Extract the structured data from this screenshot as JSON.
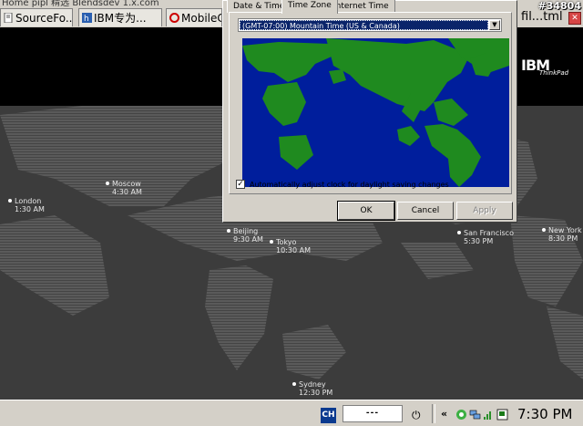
{
  "browser": {
    "top_strip_text": "Home   pipl 精选   Blendsdev 1.x.com",
    "tabs": [
      {
        "label": "SourceFo...",
        "icon": "page-icon"
      },
      {
        "label": "IBM专为...",
        "icon": "hyperlink-icon"
      },
      {
        "label": "MobileC",
        "icon": "opera-icon"
      }
    ],
    "right_title": "fil...tml",
    "stamp": "#34804"
  },
  "dialog": {
    "tabs": [
      "Date & Time",
      "Time Zone",
      "Internet Time"
    ],
    "active_tab": "Time Zone",
    "timezone_value": "(GMT-07:00) Mountain Time (US & Canada)",
    "dst_checkbox_label": "Automatically adjust clock for daylight saving changes",
    "dst_checked": true,
    "ok_label": "OK",
    "cancel_label": "Cancel",
    "apply_label": "Apply",
    "map_colors": {
      "ocean": "#001e9c",
      "land": "#1f8a1f"
    }
  },
  "world_clock": {
    "logo_text": "IBM",
    "logo_sub": "ThinkPad",
    "cities": [
      {
        "name": "London",
        "time": "1:30 AM"
      },
      {
        "name": "Moscow",
        "time": "4:30 AM"
      },
      {
        "name": "Beijing",
        "time": "9:30 AM"
      },
      {
        "name": "Tokyo",
        "time": "10:30 AM"
      },
      {
        "name": "San Francisco",
        "time": "5:30 PM"
      },
      {
        "name": "New York",
        "time": "8:30 PM"
      },
      {
        "name": "Sydney",
        "time": "12:30 PM"
      }
    ]
  },
  "taskbar": {
    "input_lang": "CH",
    "indicator": "---",
    "clock": "7:30 PM",
    "chevron": "«"
  }
}
